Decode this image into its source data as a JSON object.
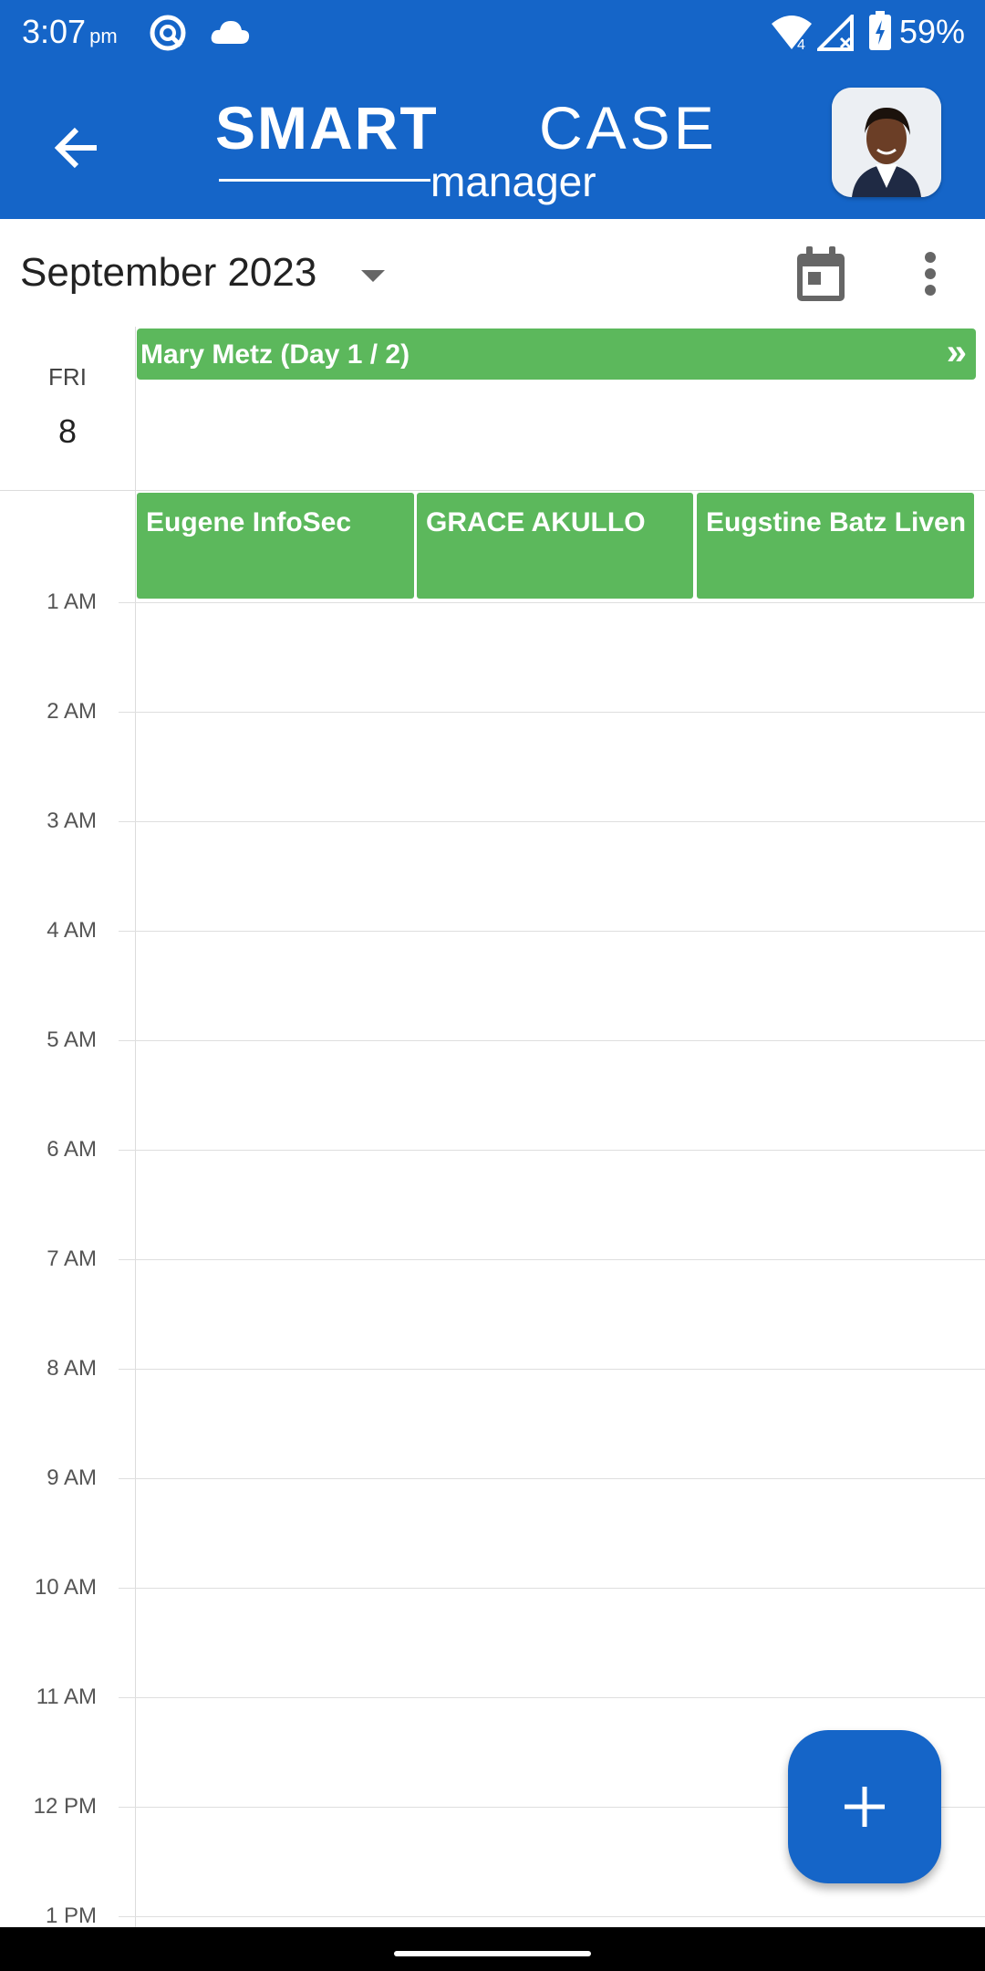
{
  "status_bar": {
    "time": "3:07",
    "ampm": "pm",
    "battery": "59%",
    "icons": [
      "sync-icon",
      "cloud-icon",
      "wifi-icon",
      "signal-icon",
      "battery-icon"
    ],
    "wifi_badge": "4"
  },
  "app_bar": {
    "logo_primary": "SMART",
    "logo_secondary": "CASE",
    "logo_tagline": "manager",
    "back_icon": "arrow-back-icon",
    "avatar_icon": "user-avatar"
  },
  "calendar": {
    "month_label": "September 2023",
    "day_name": "FRI",
    "day_number": "8",
    "all_day_event": {
      "label": "Mary Metz (Day 1 / 2)",
      "more_glyph": "»",
      "color": "#5CB85C"
    },
    "timed_events": [
      {
        "label": "Eugene InfoSec"
      },
      {
        "label": "GRACE AKULLO"
      },
      {
        "label": "Eugstine Batz Liven"
      }
    ],
    "hours": [
      "1 AM",
      "2 AM",
      "3 AM",
      "4 AM",
      "5 AM",
      "6 AM",
      "7 AM",
      "8 AM",
      "9 AM",
      "10 AM",
      "11 AM",
      "12 PM",
      "1 PM"
    ]
  },
  "colors": {
    "brand": "#1565C8",
    "event": "#5CB85C"
  },
  "fab": {
    "icon": "plus-icon"
  }
}
